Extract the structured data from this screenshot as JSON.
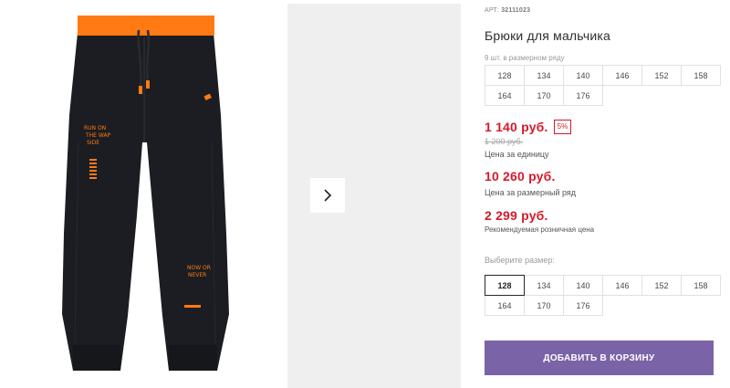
{
  "product": {
    "sku_label": "АРТ:",
    "sku_value": "32111023",
    "title": "Брюки для мальчика",
    "pack_note": "9 шт. в размерном ряду",
    "pack_sizes": [
      "128",
      "134",
      "140",
      "146",
      "152",
      "158",
      "164",
      "170",
      "176"
    ]
  },
  "pricing": {
    "unit_price": "1 140 руб.",
    "discount": "5%",
    "old_price": "1 200 руб.",
    "unit_label": "Цена за единицу",
    "pack_price": "10 260 руб.",
    "pack_label": "Цена за размерный ряд",
    "retail_price": "2 299 руб.",
    "retail_label": "Рекомендуемая розничная цена"
  },
  "size_selector": {
    "label": "Выберите размер:",
    "sizes": [
      "128",
      "134",
      "140",
      "146",
      "152",
      "158",
      "164",
      "170",
      "176"
    ],
    "selected": "128"
  },
  "cart": {
    "add_label": "ДОБАВИТЬ В КОРЗИНУ"
  },
  "gallery": {
    "print_text_top": "RUN ON THE WAP SIDE",
    "print_text_bottom": "NOW OR NEVER",
    "next_icon": "chevron-right-icon"
  },
  "colors": {
    "accent_price": "#d31b2c",
    "button": "#7a63a6",
    "waistband": "#ff7a12",
    "fabric": "#1b1d22"
  }
}
